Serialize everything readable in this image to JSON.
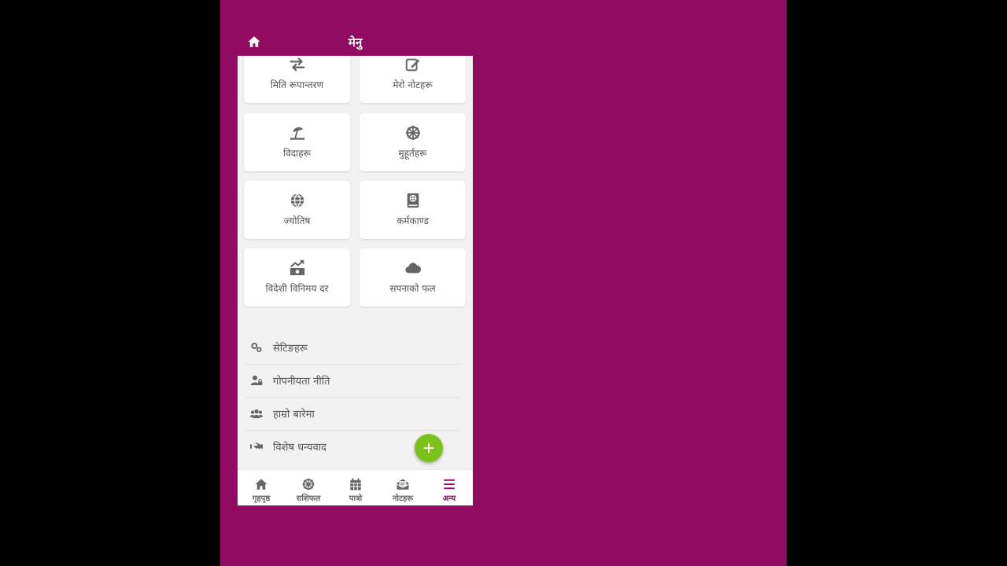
{
  "header": {
    "title": "मेनु",
    "home_icon": "home-icon"
  },
  "cards": [
    {
      "label": "मिति रूपान्तरण",
      "icon": "exchange-arrows-icon"
    },
    {
      "label": "मेरो नोटहरू",
      "icon": "edit-note-icon"
    },
    {
      "label": "विदाहरू",
      "icon": "beach-umbrella-icon"
    },
    {
      "label": "मुहूर्तहरू",
      "icon": "dharma-wheel-icon"
    },
    {
      "label": "ज्योतिष",
      "icon": "globe-icon"
    },
    {
      "label": "कर्मकाण्ड",
      "icon": "holy-book-icon"
    },
    {
      "label": "विदेशी विनिमय दर",
      "icon": "money-trend-icon"
    },
    {
      "label": "सपनाको फल",
      "icon": "cloud-icon"
    }
  ],
  "list": [
    {
      "label": "सेटिङहरू",
      "icon": "gears-icon"
    },
    {
      "label": "गोपनीयता नीति",
      "icon": "user-lock-icon"
    },
    {
      "label": "हाम्रो बारेमा",
      "icon": "users-icon"
    },
    {
      "label": "विशेष धन्यवाद",
      "icon": "handshake-icon"
    }
  ],
  "bottom_nav": [
    {
      "label": "गृहपृष्ठ",
      "icon": "home-icon"
    },
    {
      "label": "राशिफल",
      "icon": "dharma-wheel-icon"
    },
    {
      "label": "पात्रो",
      "icon": "calendar-icon"
    },
    {
      "label": "नोटहरू",
      "icon": "envelope-note-icon"
    },
    {
      "label": "अन्य",
      "icon": "menu-bars-icon",
      "active": true
    }
  ],
  "colors": {
    "brand": "#910b63",
    "fab": "#7cc21b",
    "icon": "#666666"
  }
}
